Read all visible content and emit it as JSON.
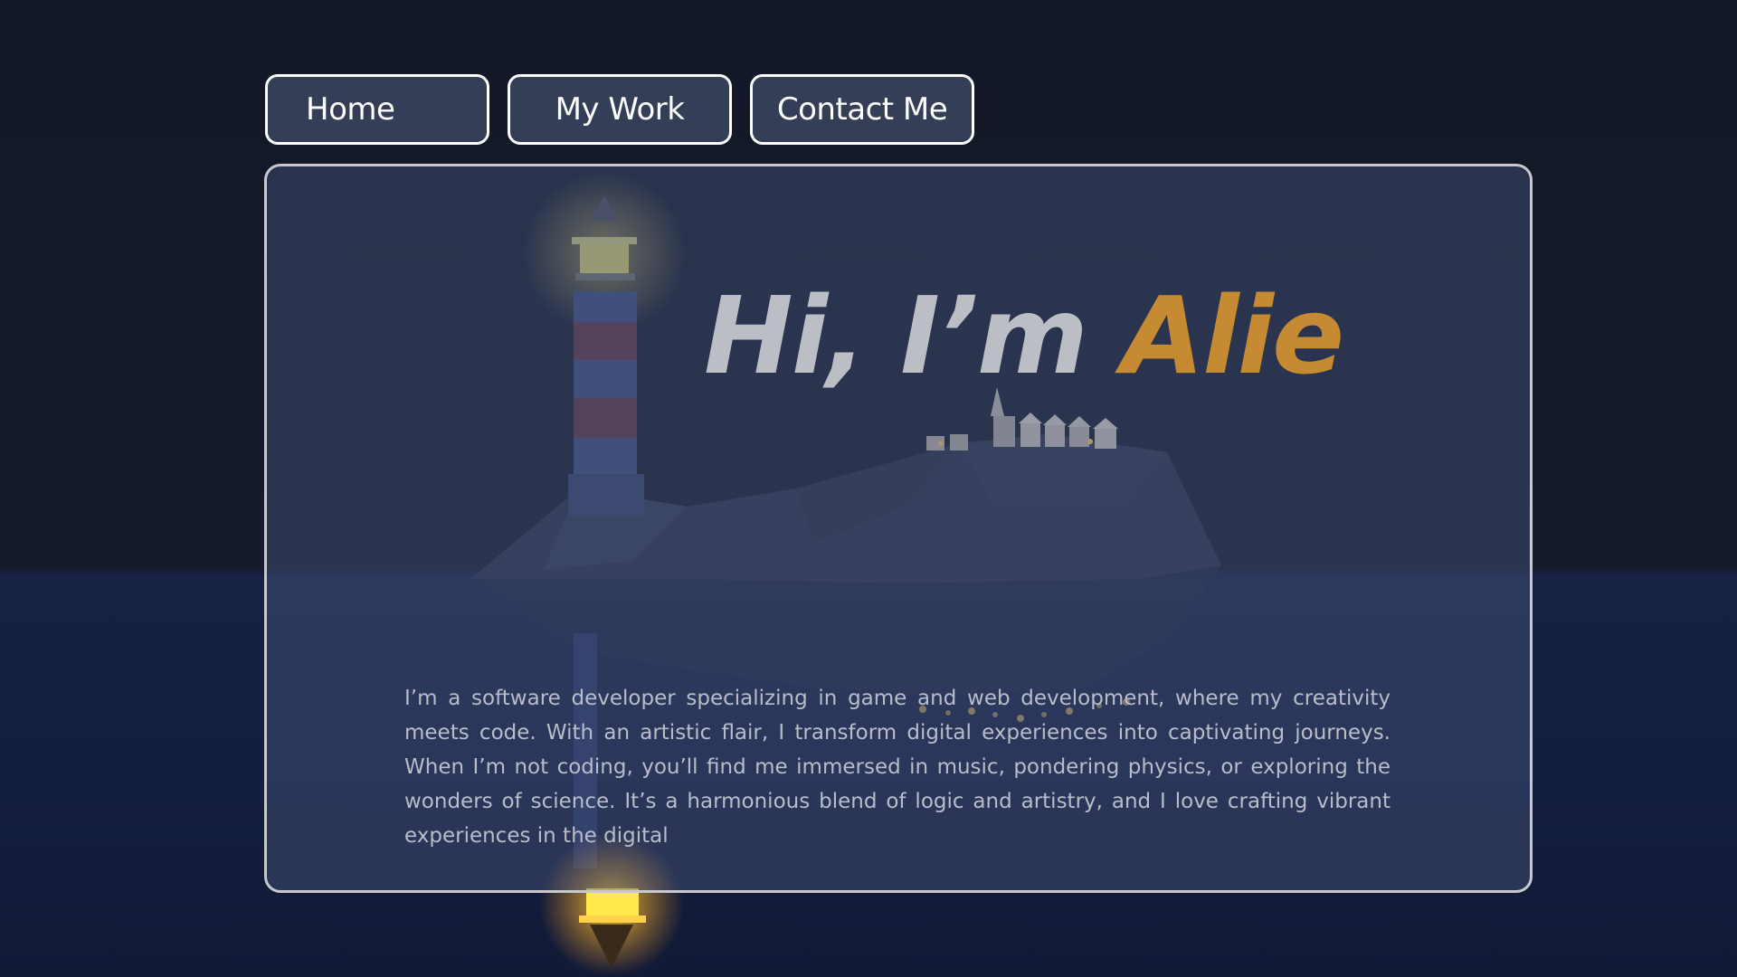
{
  "nav": {
    "items": [
      {
        "label": "Home"
      },
      {
        "label": "My Work"
      },
      {
        "label": "Contact Me"
      }
    ]
  },
  "hero": {
    "greeting": "Hi, I’m",
    "name": "Alie",
    "bio": "I’m a software developer specializing in game and web development, where my creativity meets code. With an artistic flair, I transform digital experiences into captivating journeys. When I’m not coding, you’ll find me immersed in music, pondering physics, or exploring the wonders of science. It’s a harmonious blend of logic and artistry, and I love crafting vibrant experiences in the digital"
  },
  "colors": {
    "accent": "#c58a32",
    "background": "#131827",
    "lighthouse_light": "#f5d94a"
  }
}
